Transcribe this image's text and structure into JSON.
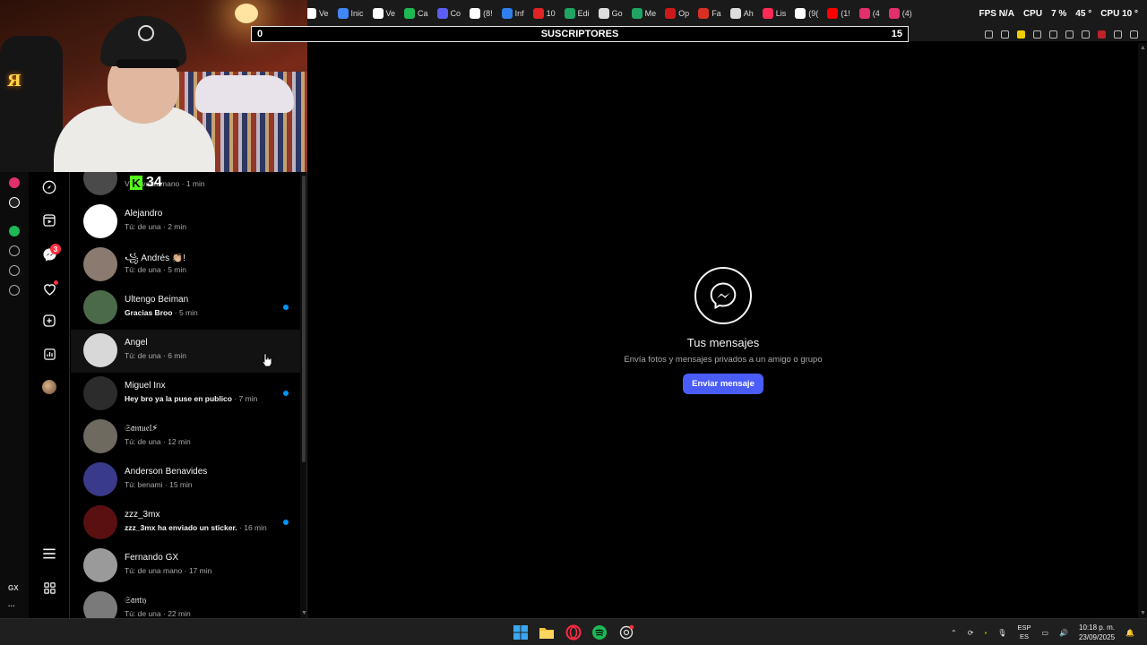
{
  "browser": {
    "tabs": [
      {
        "label": "Ve",
        "color": "#ffffff"
      },
      {
        "label": "Inic",
        "color": "#4285f4"
      },
      {
        "label": "Ve",
        "color": "#ffffff"
      },
      {
        "label": "Ca",
        "color": "#1db954"
      },
      {
        "label": "Co",
        "color": "#5b5ef0"
      },
      {
        "label": "(8!",
        "color": "#ffffff"
      },
      {
        "label": "Inf",
        "color": "#2f80ed"
      },
      {
        "label": "10",
        "color": "#e02424"
      },
      {
        "label": "Edi",
        "color": "#1fa463"
      },
      {
        "label": "Go",
        "color": "#dddddd"
      },
      {
        "label": "Me",
        "color": "#1fa463"
      },
      {
        "label": "Op",
        "color": "#cc1a1a"
      },
      {
        "label": "Fa",
        "color": "#d93025"
      },
      {
        "label": "Ah",
        "color": "#dddddd"
      },
      {
        "label": "Lis",
        "color": "#ff2a55"
      },
      {
        "label": "(9(",
        "color": "#ffffff"
      },
      {
        "label": "(1!",
        "color": "#ff0000"
      },
      {
        "label": "(4",
        "color": "#e1306c"
      },
      {
        "label": "(4)",
        "color": "#e1306c"
      }
    ],
    "stats": {
      "fps": "FPS N/A",
      "cpu_label": "CPU",
      "cpu_value": "7 %",
      "temp": "45 °",
      "cpu2": "CPU 10 °"
    }
  },
  "stream": {
    "sub_goal": {
      "start": "0",
      "title": "SUSCRIPTORES",
      "end": "15"
    },
    "kick_viewers": "34",
    "kick_letter": "K"
  },
  "sidestrip": {
    "gx_label": "GX",
    "more_label": "···"
  },
  "nav": {
    "messages_badge": "3",
    "items": [
      "explore-icon",
      "reels-icon",
      "messenger-icon",
      "heart-icon",
      "create-icon",
      "dashboard-icon",
      "profile-avatar",
      "menu-icon",
      "apps-icon"
    ]
  },
  "conversations": [
    {
      "name": "",
      "preview": "Vi",
      "preview_tail": " privada mano",
      "time": "1 min",
      "unread": false,
      "avatar": "#4a4a4a"
    },
    {
      "name": "Alejandro",
      "preview": "Tú: de una",
      "time": "2 min",
      "unread": false,
      "avatar": "#ffffff"
    },
    {
      "name": "꧁ Andrés 👏🏼!",
      "preview": "Tú: de una",
      "time": "5 min",
      "unread": false,
      "avatar": "#8a7a70"
    },
    {
      "name": "Ultengo Beiman",
      "preview": "Gracias Broo",
      "time": "5 min",
      "unread": true,
      "avatar": "#4b6a4a"
    },
    {
      "name": "Angel",
      "preview": "Tú: de una",
      "time": "6 min",
      "unread": false,
      "avatar": "#d8d8d8"
    },
    {
      "name": "Miguel Inx",
      "preview": "Hey bro ya la puse en publico",
      "time": "7 min",
      "unread": true,
      "avatar": "#2c2c2c"
    },
    {
      "name": "𝔖𝔞𝔪𝔲𝔢𝔩⚡",
      "preview": "Tú: de una",
      "time": "12 min",
      "unread": false,
      "avatar": "#6f6a60"
    },
    {
      "name": "Anderson Benavides",
      "preview": "Tú: benami",
      "time": "15 min",
      "unread": false,
      "avatar": "#3a3a8a"
    },
    {
      "name": "zzz_3mx",
      "preview": "zzz_3mx ha enviado un sticker.",
      "time": "16 min",
      "unread": true,
      "avatar": "#5a1010"
    },
    {
      "name": "Fernando GX",
      "preview": "Tú: de una mano",
      "time": "17 min",
      "unread": false,
      "avatar": "#9a9a9a"
    },
    {
      "name": "𝔖𝔞𝔫𝔱𝔶",
      "preview": "Tú: de una",
      "time": "22 min",
      "unread": false,
      "avatar": "#7a7a7a"
    }
  ],
  "main": {
    "title": "Tus mensajes",
    "subtitle": "Envía fotos y mensajes privados a un amigo o grupo",
    "button": "Enviar mensaje"
  },
  "taskbar": {
    "lang_top": "ESP",
    "lang_bottom": "ES",
    "time": "10:18 p. m.",
    "date": "23/09/2025"
  },
  "colors": {
    "accent": "#4a5df9",
    "unread": "#0095f6",
    "badge": "#ff3040"
  }
}
